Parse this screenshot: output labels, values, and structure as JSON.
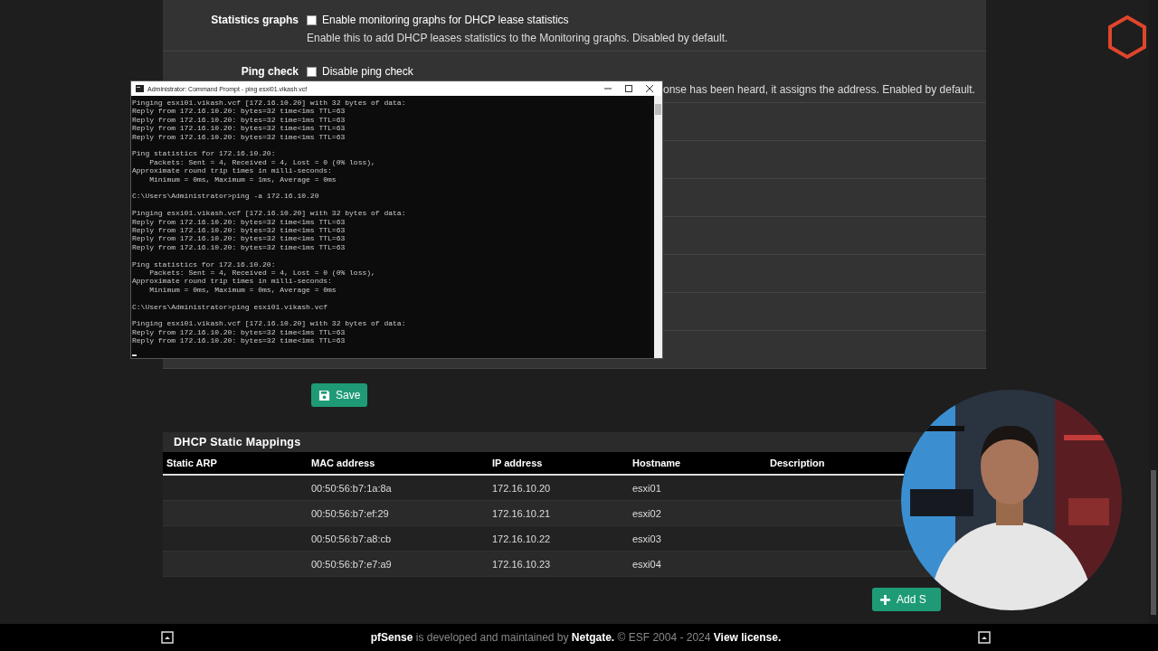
{
  "settings": [
    {
      "label": "Statistics graphs",
      "checkbox": {
        "label": "Enable monitoring graphs for DHCP lease statistics",
        "checked": false
      },
      "help": "Enable this to add DHCP leases statistics to the Monitoring graphs. Disabled by default."
    },
    {
      "label": "Ping check",
      "checkbox": {
        "label": "Disable ping check",
        "checked": false
      },
      "help": "onse has been heard, it assigns the address. Enabled by default."
    }
  ],
  "terminal": {
    "title": "Administrator: Command Prompt - ping  esxi01.vikash.vcf",
    "blocks": [
      [
        "Pinging esxi01.vikash.vcf [172.16.10.20] with 32 bytes of data:",
        "Reply from 172.16.10.20: bytes=32 time<1ms TTL=63",
        "Reply from 172.16.10.20: bytes=32 time=1ms TTL=63",
        "Reply from 172.16.10.20: bytes=32 time<1ms TTL=63",
        "Reply from 172.16.10.20: bytes=32 time<1ms TTL=63"
      ],
      [
        "Ping statistics for 172.16.10.20:",
        "    Packets: Sent = 4, Received = 4, Lost = 0 (0% loss),",
        "Approximate round trip times in milli-seconds:",
        "    Minimum = 0ms, Maximum = 1ms, Average = 0ms"
      ],
      [
        "C:\\Users\\Administrator>ping -a 172.16.10.20"
      ],
      [
        "Pinging esxi01.vikash.vcf [172.16.10.20] with 32 bytes of data:",
        "Reply from 172.16.10.20: bytes=32 time<1ms TTL=63",
        "Reply from 172.16.10.20: bytes=32 time<1ms TTL=63",
        "Reply from 172.16.10.20: bytes=32 time<1ms TTL=63",
        "Reply from 172.16.10.20: bytes=32 time<1ms TTL=63"
      ],
      [
        "Ping statistics for 172.16.10.20:",
        "    Packets: Sent = 4, Received = 4, Lost = 0 (0% loss),",
        "Approximate round trip times in milli-seconds:",
        "    Minimum = 0ms, Maximum = 0ms, Average = 0ms"
      ],
      [
        "C:\\Users\\Administrator>ping esxi01.vikash.vcf"
      ],
      [
        "Pinging esxi01.vikash.vcf [172.16.10.20] with 32 bytes of data:",
        "Reply from 172.16.10.20: bytes=32 time<1ms TTL=63",
        "Reply from 172.16.10.20: bytes=32 time<1ms TTL=63"
      ]
    ]
  },
  "save_button": "Save",
  "mappings": {
    "title": "DHCP Static Mappings",
    "columns": [
      "Static ARP",
      "MAC address",
      "IP address",
      "Hostname",
      "Description"
    ],
    "rows": [
      [
        "",
        "00:50:56:b7:1a:8a",
        "172.16.10.20",
        "esxi01",
        ""
      ],
      [
        "",
        "00:50:56:b7:ef:29",
        "172.16.10.21",
        "esxi02",
        ""
      ],
      [
        "",
        "00:50:56:b7:a8:cb",
        "172.16.10.22",
        "esxi03",
        ""
      ],
      [
        "",
        "00:50:56:b7:e7:a9",
        "172.16.10.23",
        "esxi04",
        ""
      ]
    ],
    "add_button": "Add S"
  },
  "footer": {
    "brand": "pfSense",
    "text": " is developed and maintained by ",
    "company": "Netgate.",
    "copyright": " © ESF 2004 - 2024 ",
    "license": "View license."
  }
}
